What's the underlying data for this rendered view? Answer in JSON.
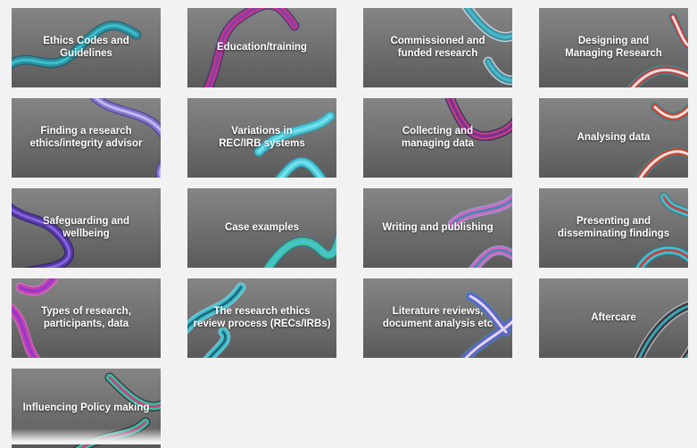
{
  "tiles": [
    {
      "label": "Ethics Codes and\nGuidelines",
      "colors": [
        "#2a9aa8",
        "#3fc3d1",
        "#1c5e70"
      ]
    },
    {
      "label": "Education/training",
      "colors": [
        "#d4357f",
        "#7d3fb5",
        "#2d2f7a"
      ]
    },
    {
      "label": "Commissioned and\nfunded research",
      "colors": [
        "#2f8fa0",
        "#47bfd0",
        "#e8e8f0"
      ]
    },
    {
      "label": "Designing and\nManaging Research",
      "colors": [
        "#c83c3c",
        "#f0f0f0",
        "#2c9aa0"
      ]
    },
    {
      "label": "Finding a research\nethics/integrity advisor",
      "colors": [
        "#8a7ad8",
        "#c8c0f0",
        "#4a3e9a"
      ]
    },
    {
      "label": "Variations in\nREC/IRB systems",
      "colors": [
        "#4fd0e0",
        "#7ae4f0",
        "#2aa8c0"
      ]
    },
    {
      "label": "Collecting and\nmanaging data",
      "colors": [
        "#d04080",
        "#6a2f9a",
        "#2a2060"
      ]
    },
    {
      "label": "Analysing data",
      "colors": [
        "#d0402c",
        "#f2f2f2",
        "#2c8c96"
      ]
    },
    {
      "label": "Safeguarding and\nwellbeing",
      "colors": [
        "#5a3ab0",
        "#8a6ae0",
        "#2a1a70"
      ]
    },
    {
      "label": "Case examples",
      "colors": [
        "#3fd0a0",
        "#4ac0e0",
        "#2a7aa0"
      ]
    },
    {
      "label": "Writing and publishing",
      "colors": [
        "#e060c0",
        "#3a8ab0",
        "#a0a0e8"
      ]
    },
    {
      "label": "Presenting and\ndisseminating findings",
      "colors": [
        "#48c8d8",
        "#c83a3a",
        "#2a8090"
      ]
    },
    {
      "label": "Types of research,\nparticipants, data",
      "colors": [
        "#c83ab0",
        "#8a3ad0",
        "#e070d0"
      ]
    },
    {
      "label": "The research ethics\nreview process (RECs/IRBs)",
      "colors": [
        "#3ac0d0",
        "#1a6070",
        "#7ae0f0"
      ]
    },
    {
      "label": "Literature reviews,\ndocument analysis etc",
      "colors": [
        "#6a5ad0",
        "#e8e8f0",
        "#3a8ab0"
      ]
    },
    {
      "label": "Aftercare",
      "colors": [
        "#2a2a30",
        "#3ab0c0",
        "#c8c8d0"
      ]
    },
    {
      "label": "Influencing Policy making",
      "colors": [
        "#3ad0a0",
        "#d03a8a",
        "#2a2a40"
      ]
    }
  ]
}
